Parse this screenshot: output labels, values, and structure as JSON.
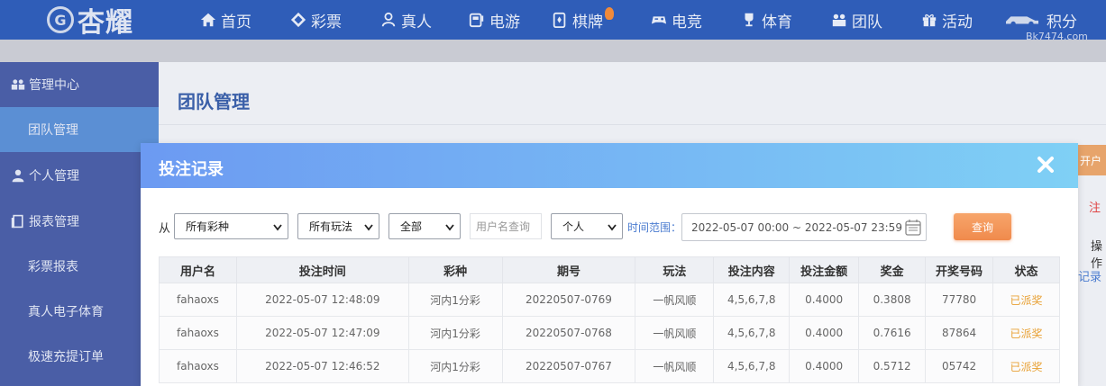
{
  "brand": {
    "mark": "G",
    "name": "杏耀"
  },
  "nav": [
    {
      "id": "home",
      "label": "首页",
      "icon": "home-icon"
    },
    {
      "id": "lottery",
      "label": "彩票",
      "icon": "diamond-icon"
    },
    {
      "id": "live",
      "label": "真人",
      "icon": "person-icon"
    },
    {
      "id": "slots",
      "label": "电游",
      "icon": "slot-machine-icon"
    },
    {
      "id": "cards",
      "label": "棋牌",
      "icon": "cards-icon"
    },
    {
      "id": "esports",
      "label": "电竞",
      "icon": "gamepad-icon"
    },
    {
      "id": "sports",
      "label": "体育",
      "icon": "trophy-icon"
    },
    {
      "id": "team",
      "label": "团队",
      "icon": "team-icon"
    },
    {
      "id": "events",
      "label": "活动",
      "icon": "gift-icon"
    },
    {
      "id": "points",
      "label": "积分",
      "icon": "car-icon"
    }
  ],
  "watermark": "Bk7474.com",
  "sidebar": {
    "items": [
      {
        "label": "管理中心",
        "type": "group",
        "icon": "team-icon"
      },
      {
        "label": "团队管理",
        "type": "sub",
        "active": true
      },
      {
        "label": "个人管理",
        "type": "group",
        "icon": "user-icon"
      },
      {
        "label": "报表管理",
        "type": "group",
        "icon": "report-icon"
      },
      {
        "label": "彩票报表",
        "type": "sub"
      },
      {
        "label": "真人电子体育",
        "type": "sub"
      },
      {
        "label": "极速充提订单",
        "type": "sub"
      }
    ]
  },
  "page": {
    "title": "团队管理",
    "peek_orange": "开户",
    "peek_red": "注",
    "peek_op": "操作",
    "peek_link": "记录"
  },
  "modal": {
    "title": "投注记录",
    "filters": {
      "from_label": "从",
      "lottery_select": "所有彩种",
      "play_select": "所有玩法",
      "status_select": "全部",
      "username_placeholder": "用户名查询",
      "scope_select": "个人",
      "time_label": "时间范围：",
      "date_range": "2022-05-07 00:00 ~ 2022-05-07 23:59",
      "query_button": "查询"
    },
    "table": {
      "columns": [
        "用户名",
        "投注时间",
        "彩种",
        "期号",
        "玩法",
        "投注内容",
        "投注金额",
        "奖金",
        "开奖号码",
        "状态"
      ],
      "rows": [
        [
          "fahaoxs",
          "2022-05-07 12:48:09",
          "河内1分彩",
          "20220507-0769",
          "一帆风顺",
          "4,5,6,7,8",
          "0.4000",
          "0.3808",
          "77780",
          "已派奖"
        ],
        [
          "fahaoxs",
          "2022-05-07 12:47:09",
          "河内1分彩",
          "20220507-0768",
          "一帆风顺",
          "4,5,6,7,8",
          "0.4000",
          "0.7616",
          "87864",
          "已派奖"
        ],
        [
          "fahaoxs",
          "2022-05-07 12:46:52",
          "河内1分彩",
          "20220507-0767",
          "一帆风顺",
          "4,5,6,7,8",
          "0.4000",
          "0.5712",
          "05742",
          "已派奖"
        ]
      ]
    }
  },
  "colors": {
    "topbar": "#2f5db8",
    "sidebar": "#4a5ea6",
    "sidebar_active": "#5b8fd4",
    "modal_header_start": "#6c9af2",
    "modal_header_end": "#7fd0f5",
    "query_button": "#f08a4c",
    "status_paid": "#e8a033"
  }
}
